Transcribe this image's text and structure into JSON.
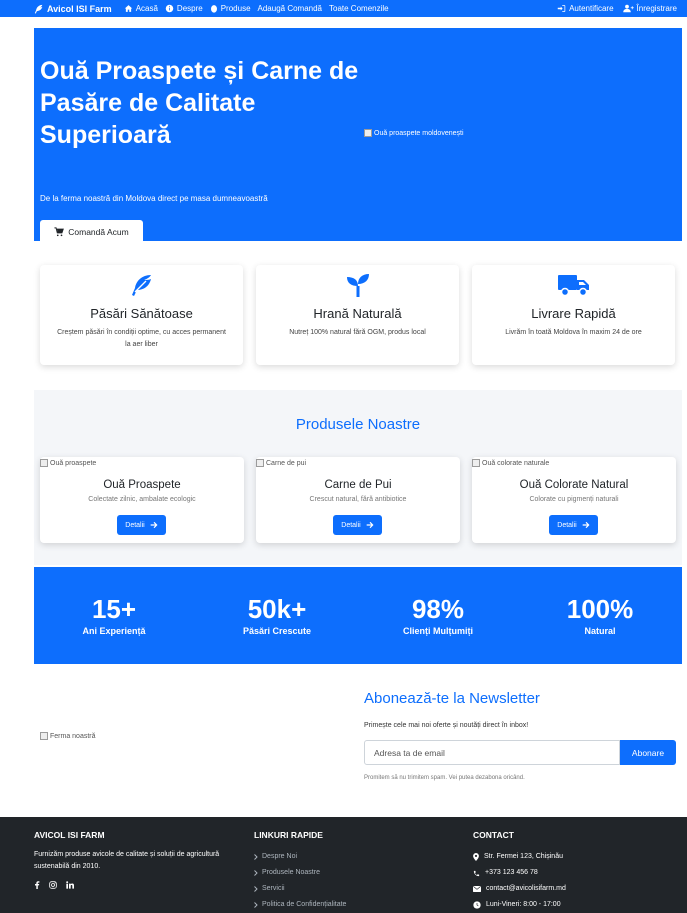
{
  "colors": {
    "primary": "#0d6efd",
    "footer_bg": "#212529",
    "section_bg": "#f4f6f9"
  },
  "nav": {
    "brand": "Avicol ISI Farm",
    "brand_icon": "feather-icon",
    "items": [
      {
        "label": "Acasă",
        "icon": "home-icon"
      },
      {
        "label": "Despre",
        "icon": "info-icon"
      },
      {
        "label": "Produse",
        "icon": "egg-icon"
      },
      {
        "label": "Adaugă Comandă",
        "icon": ""
      },
      {
        "label": "Toate Comenzile",
        "icon": ""
      }
    ],
    "login": "Autentificare",
    "register": "Înregistrare"
  },
  "hero": {
    "title": "Ouă Proaspete și Carne de Pasăre de Calitate Superioară",
    "subtitle": "De la ferma noastră din Moldova direct pe masa dumneavoastră",
    "cta": "Comandă Acum",
    "image_alt": "Ouă proaspete moldovenești"
  },
  "features": [
    {
      "icon": "feather-icon",
      "title": "Păsări Sănătoase",
      "text": "Creștem păsări în condiții optime, cu acces permanent la aer liber"
    },
    {
      "icon": "seedling-icon",
      "title": "Hrană Naturală",
      "text": "Nutreț 100% natural fără OGM, produs local"
    },
    {
      "icon": "truck-icon",
      "title": "Livrare Rapidă",
      "text": "Livrăm în toată Moldova în maxim 24 de ore"
    }
  ],
  "products": {
    "heading": "Produsele Noastre",
    "button_label": "Detalii",
    "items": [
      {
        "image_alt": "Ouă proaspete",
        "title": "Ouă Proaspete",
        "text": "Colectate zilnic, ambalate ecologic"
      },
      {
        "image_alt": "Carne de pui",
        "title": "Carne de Pui",
        "text": "Crescut natural, fără antibiotice"
      },
      {
        "image_alt": "Ouă colorate naturale",
        "title": "Ouă Colorate Natural",
        "text": "Colorate cu pigmenți naturali"
      }
    ]
  },
  "stats": [
    {
      "value": "15+",
      "label": "Ani Experiență"
    },
    {
      "value": "50k+",
      "label": "Păsări Crescute"
    },
    {
      "value": "98%",
      "label": "Clienți Mulțumiți"
    },
    {
      "value": "100%",
      "label": "Natural"
    }
  ],
  "newsletter": {
    "image_alt": "Ferma noastră",
    "title": "Abonează-te la Newsletter",
    "text": "Primește cele mai noi oferte și noutăți direct în inbox!",
    "placeholder": "Adresa ta de email",
    "button": "Abonare",
    "note": "Promitem să nu trimitem spam. Vei putea dezabona oricând."
  },
  "footer": {
    "about_title": "AVICOL ISI FARM",
    "about_text": "Furnizăm produse avicole de calitate și soluții de agricultură sustenabilă din 2010.",
    "links_title": "LINKURI RAPIDE",
    "links": [
      "Despre Noi",
      "Produsele Noastre",
      "Servicii",
      "Politica de Confidențialitate"
    ],
    "contact_title": "CONTACT",
    "address": "Str. Fermei 123, Chișinău",
    "phone": "+373 123 456 78",
    "email": "contact@avicolisifarm.md",
    "hours": "Luni-Vineri: 8:00 - 17:00"
  }
}
